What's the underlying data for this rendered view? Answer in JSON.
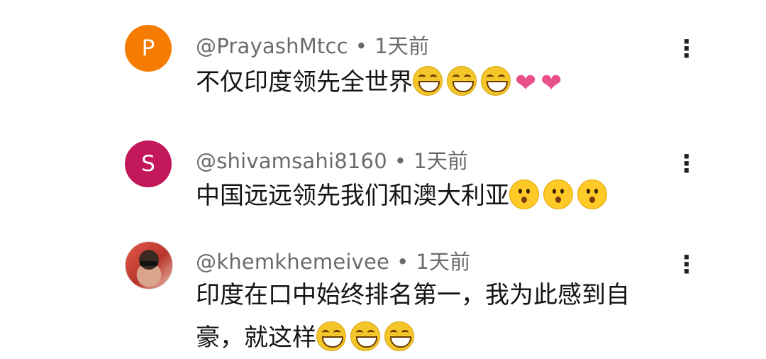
{
  "comments": [
    {
      "avatar_letter": "P",
      "avatar_color": "#f57c00",
      "author": "@PrayashMtcc",
      "separator": "•",
      "time": "1天前",
      "text": "不仅印度领先全世界",
      "reactions": [
        "laugh-emoji",
        "laugh-emoji",
        "laugh-emoji",
        "heart-emoji",
        "heart-emoji"
      ],
      "menu_icon": "more-vertical-icon"
    },
    {
      "avatar_letter": "S",
      "avatar_color": "#c2185b",
      "author": "@shivamsahi8160",
      "separator": "•",
      "time": "1天前",
      "text": "中国远远领先我们和澳大利亚",
      "reactions": [
        "surprised-emoji",
        "surprised-emoji",
        "surprised-emoji"
      ],
      "menu_icon": "more-vertical-icon"
    },
    {
      "avatar_type": "photo",
      "author": "@khemkhemeivee",
      "separator": "•",
      "time": "1天前",
      "text": "印度在口中始终排名第一，我为此感到自豪，就这样",
      "reactions": [
        "laugh-emoji",
        "laugh-emoji",
        "laugh-emoji"
      ],
      "menu_icon": "more-vertical-icon"
    }
  ],
  "menu_glyph": "⋮"
}
